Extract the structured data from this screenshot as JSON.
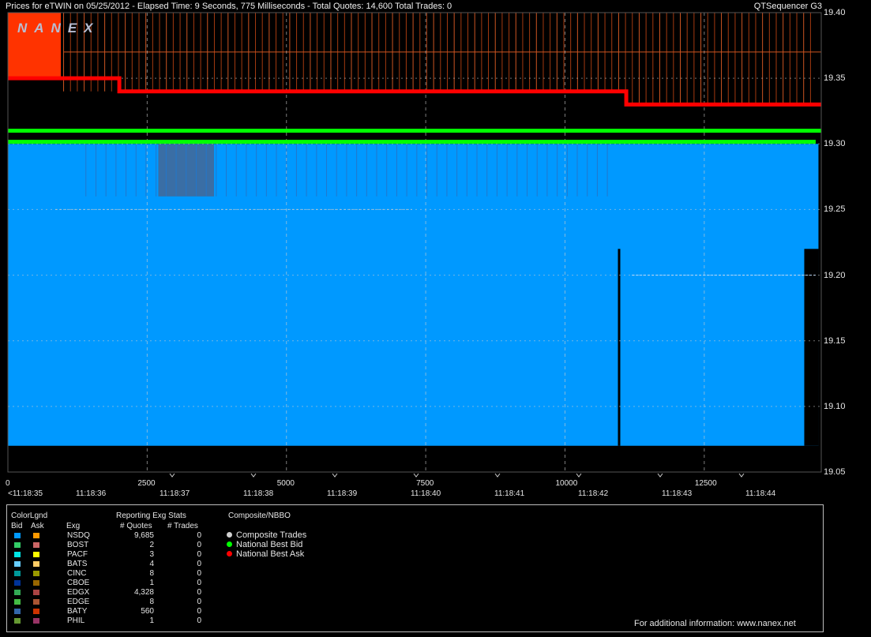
{
  "header": {
    "title": "Prices for  eTWIN  on  05/25/2012  -  Elapsed Time: 9 Seconds, 775 Milliseconds  -  Total Quotes: 14,600  Total Trades: 0",
    "app_name": "QTSequencer G3",
    "logo": "NANEX"
  },
  "chart_data": {
    "type": "line",
    "title": "Prices for eTWIN on 05/25/2012",
    "y_ticks": [
      "19.40",
      "19.35",
      "19.30",
      "19.25",
      "19.20",
      "19.15",
      "19.10",
      "19.05"
    ],
    "ylim": [
      19.05,
      19.4
    ],
    "x_ticks_index": [
      "0",
      "2500",
      "5000",
      "7500",
      "10000",
      "12500"
    ],
    "x_ticks_time": [
      "<11:18:35",
      "11:18:36",
      "11:18:37",
      "11:18:38",
      "11:18:39",
      "11:18:40",
      "11:18:41",
      "11:18:42",
      "11:18:43",
      "11:18:44"
    ],
    "xlim": [
      0,
      14600
    ],
    "grid": true,
    "series": [
      {
        "name": "National Best Bid",
        "color": "#00ff00",
        "x": [
          0,
          14600
        ],
        "y": [
          19.31,
          19.31
        ]
      },
      {
        "name": "National Best Ask",
        "color": "#ff0000",
        "x": [
          0,
          2000,
          2000,
          11100,
          11100,
          14600
        ],
        "y": [
          19.35,
          19.35,
          19.34,
          19.34,
          19.33,
          19.33
        ]
      }
    ],
    "bid_area": {
      "color": "#0099ff",
      "top": 19.3,
      "bottom": 19.07,
      "x_end": 14550
    },
    "ask_area": {
      "color": "#ff3300",
      "top": 19.4,
      "bottom": 19.35,
      "x_end": 950
    }
  },
  "legend_panel": {
    "title": "ColorLgnd",
    "col_bid": "Bid",
    "col_ask": "Ask",
    "col_exg": "Exg",
    "stats_title": "Reporting Exg Stats",
    "col_quotes": "# Quotes",
    "col_trades": "# Trades",
    "nbbo_title": "Composite/NBBO",
    "nbbo_items": [
      {
        "label": "Composite Trades",
        "color": "#d0d0d0"
      },
      {
        "label": "National Best Bid",
        "color": "#00ff00"
      },
      {
        "label": "National Best Ask",
        "color": "#ff0000"
      }
    ],
    "rows": [
      {
        "exg": "NSDQ",
        "quotes": "9,685",
        "trades": "0",
        "bid_color": "#0099ff",
        "ask_color": "#ff9900"
      },
      {
        "exg": "BOST",
        "quotes": "2",
        "trades": "0",
        "bid_color": "#33cc66",
        "ask_color": "#cc6666"
      },
      {
        "exg": "PACF",
        "quotes": "3",
        "trades": "0",
        "bid_color": "#00e5e5",
        "ask_color": "#ffff00"
      },
      {
        "exg": "BATS",
        "quotes": "4",
        "trades": "0",
        "bid_color": "#66ccff",
        "ask_color": "#ffcc66"
      },
      {
        "exg": "CINC",
        "quotes": "8",
        "trades": "0",
        "bid_color": "#009999",
        "ask_color": "#999900"
      },
      {
        "exg": "CBOE",
        "quotes": "1",
        "trades": "0",
        "bid_color": "#003399",
        "ask_color": "#996600"
      },
      {
        "exg": "EDGX",
        "quotes": "4,328",
        "trades": "0",
        "bid_color": "#33aa55",
        "ask_color": "#aa4444"
      },
      {
        "exg": "EDGE",
        "quotes": "8",
        "trades": "0",
        "bid_color": "#44bb44",
        "ask_color": "#aa5533"
      },
      {
        "exg": "BATY",
        "quotes": "560",
        "trades": "0",
        "bid_color": "#3366aa",
        "ask_color": "#cc3300"
      },
      {
        "exg": "PHIL",
        "quotes": "1",
        "trades": "0",
        "bid_color": "#669933",
        "ask_color": "#993366"
      }
    ],
    "footer": "For additional information: www.nanex.net"
  }
}
